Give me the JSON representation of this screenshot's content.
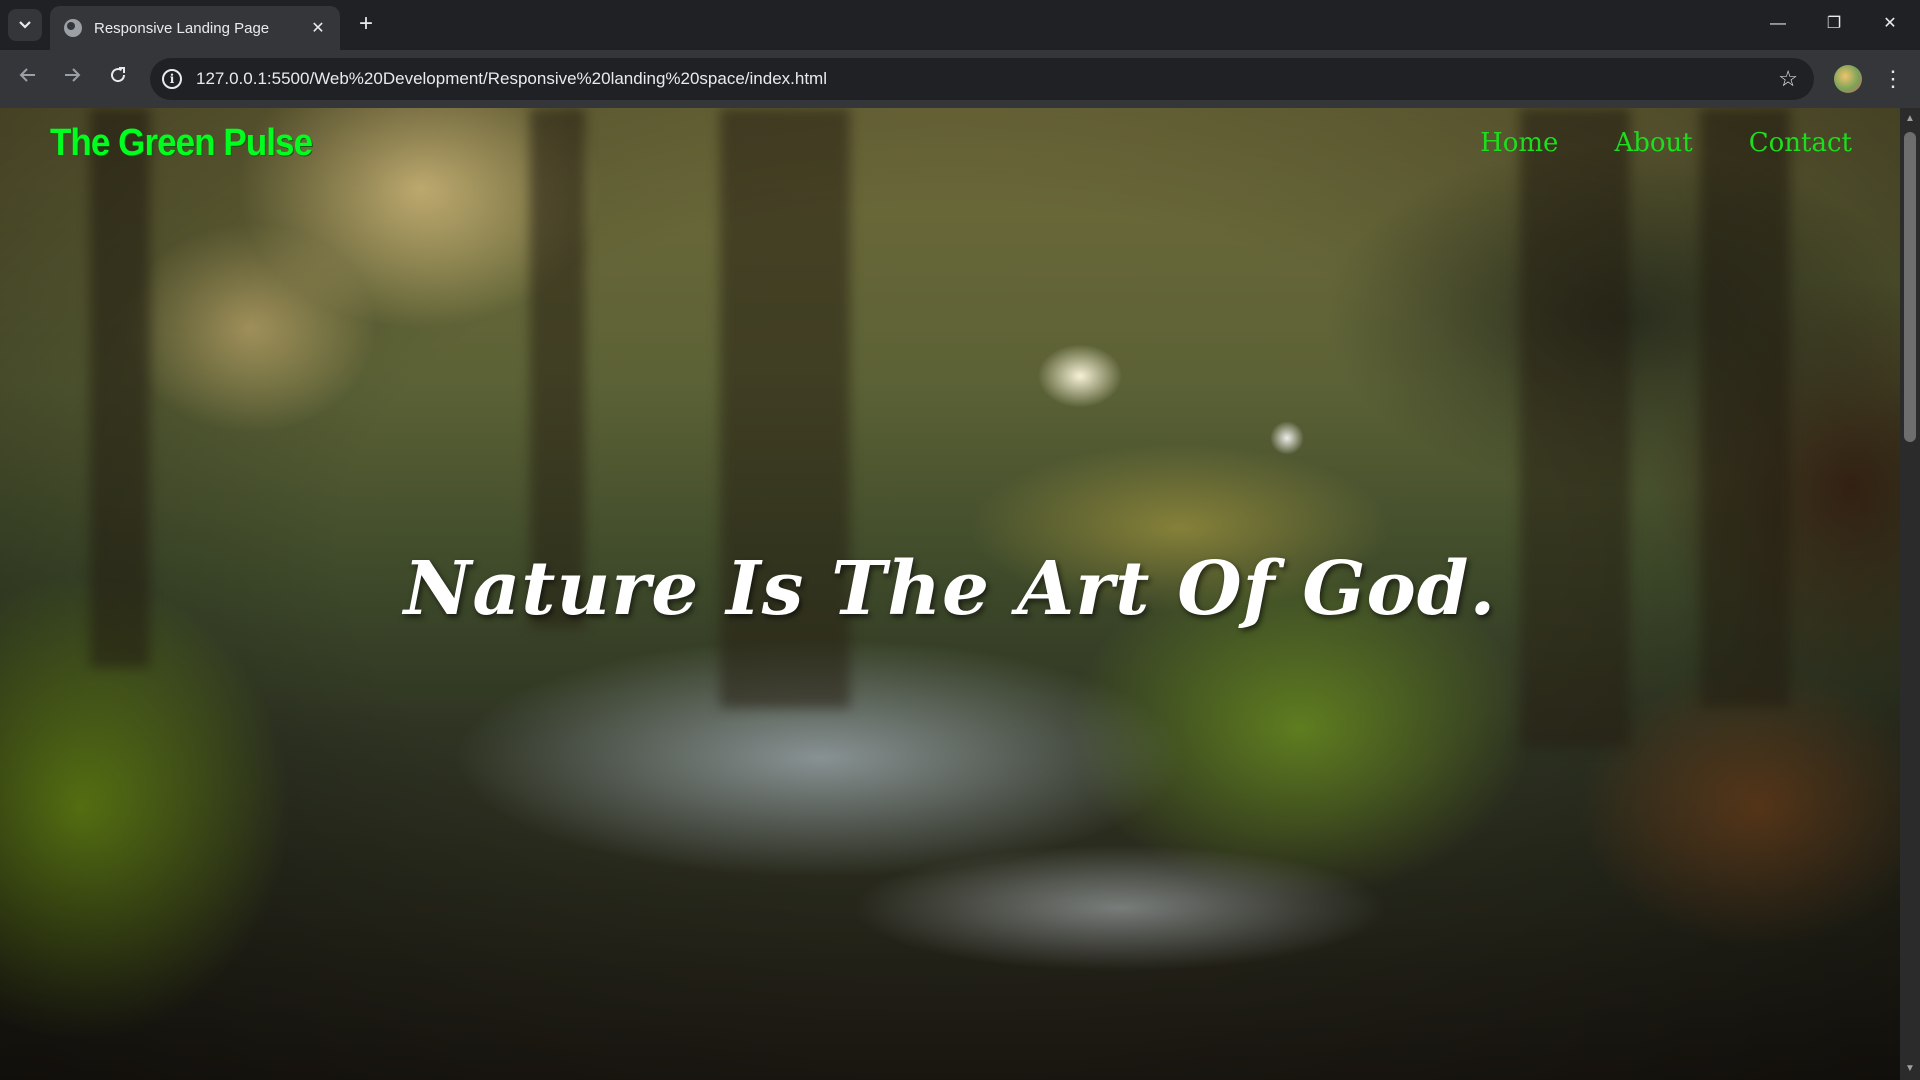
{
  "browser": {
    "tab_title": "Responsive Landing Page",
    "tab_close": "✕",
    "new_tab": "+",
    "url": "127.0.0.1:5500/Web%20Development/Responsive%20landing%20space/index.html",
    "window_controls": {
      "minimize": "—",
      "restore": "❐",
      "close": "✕"
    },
    "icons": {
      "tab_search": "chevron-down-icon",
      "back": "back-arrow-icon",
      "forward": "forward-arrow-icon",
      "reload": "reload-icon",
      "site_info": "info-icon",
      "bookmark": "star-icon",
      "menu": "three-dot-menu-icon"
    }
  },
  "site": {
    "logo": "The Green Pulse",
    "nav": [
      "Home",
      "About",
      "Contact"
    ],
    "hero_text": "Nature Is The Art Of God.",
    "colors": {
      "logo": "#00ff1e",
      "nav": "#1edc1e",
      "hero": "#ffffff"
    }
  }
}
